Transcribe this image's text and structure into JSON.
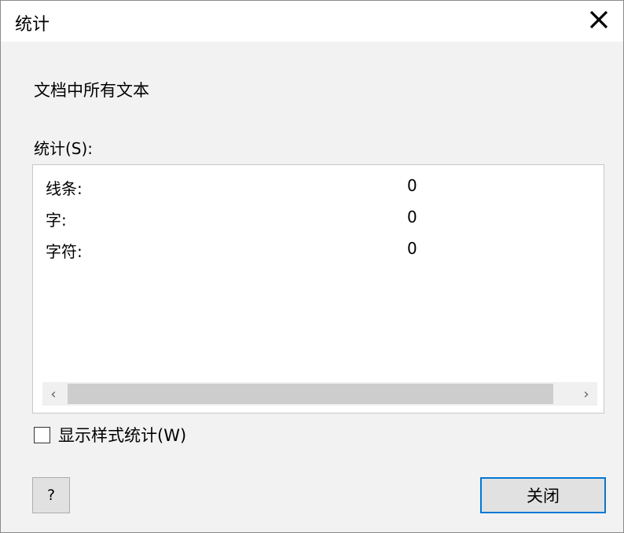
{
  "window": {
    "title": "统计"
  },
  "scope_text": "文档中所有文本",
  "stats": {
    "label": "统计(S):",
    "rows": [
      {
        "name": "线条:",
        "value": "0"
      },
      {
        "name": "字:",
        "value": "0"
      },
      {
        "name": "字符:",
        "value": "0"
      }
    ]
  },
  "scrollbar": {
    "left_arrow": "‹",
    "right_arrow": "›"
  },
  "checkbox": {
    "label": "显示样式统计(W)",
    "checked": false
  },
  "buttons": {
    "help": "?",
    "close": "关闭"
  },
  "icons": {
    "close": "close-icon",
    "left": "chevron-left-icon",
    "right": "chevron-right-icon"
  },
  "colors": {
    "accent": "#0078d7"
  }
}
